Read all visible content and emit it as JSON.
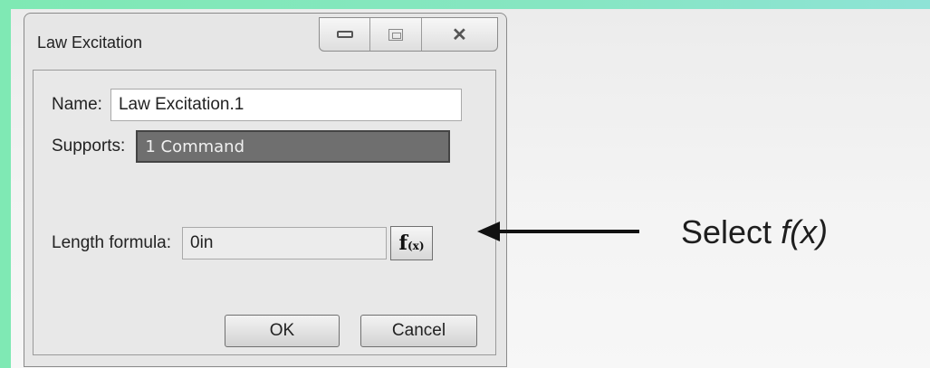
{
  "window": {
    "title": "Law Excitation",
    "controls": [
      "minimize",
      "maximize",
      "close"
    ]
  },
  "form": {
    "name_label": "Name:",
    "name_value": "Law Excitation.1",
    "supports_label": "Supports:",
    "supports_value": "1 Command",
    "length_label": "Length formula:",
    "length_value": "0in",
    "fx_button": {
      "main": "f",
      "sub": "(x)"
    }
  },
  "buttons": {
    "ok": "OK",
    "cancel": "Cancel"
  },
  "callout": {
    "prefix": "Select ",
    "emphasis": "f(x)"
  },
  "colors": {
    "border_accent": "#7fe9b4",
    "selection_bg": "#6f6f6f"
  },
  "icons": [
    "minimize-icon",
    "maximize-icon",
    "close-icon",
    "function-icon",
    "arrow-left-icon"
  ]
}
